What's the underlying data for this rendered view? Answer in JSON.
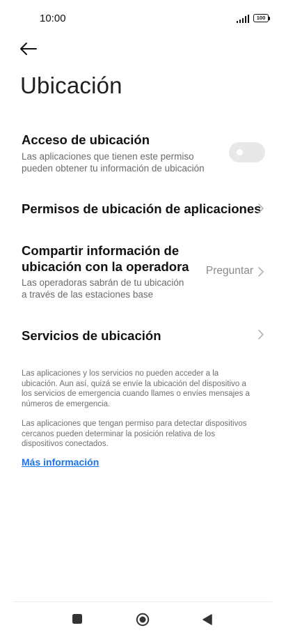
{
  "status_bar": {
    "time": "10:00",
    "battery": "100"
  },
  "header": {
    "back_icon": "arrow-left-icon",
    "title": "Ubicación"
  },
  "settings": {
    "location_access": {
      "title": "Acceso de ubicación",
      "subtitle_line1": "Las aplicaciones que tienen este permiso",
      "subtitle_line2": "pueden obtener tu información de ubicación",
      "toggle_on": false
    },
    "app_permissions": {
      "title": "Permisos de ubicación de aplicaciones"
    },
    "carrier_sharing": {
      "title_line1": "Compartir información de",
      "title_line2": "ubicación con la operadora",
      "subtitle_line1": "Las operadoras sabrán de tu ubicación",
      "subtitle_line2": "a través de las estaciones base",
      "value": "Preguntar"
    },
    "location_services": {
      "title": "Servicios de ubicación"
    }
  },
  "footnotes": {
    "note1_lines": [
      "Las aplicaciones y los servicios no pueden acceder a la",
      "ubicación. Aun así, quizá se envíe la ubicación del dispositivo a",
      "los servicios de emergencia cuando llames o envíes mensajes a",
      "números de emergencia."
    ],
    "note2_lines": [
      "Las aplicaciones que tengan permiso para detectar dispositivos",
      "cercanos pueden determinar la posición relativa de los",
      "dispositivos conectados."
    ],
    "more_info": "Más información"
  },
  "nav_bar": {
    "recents_icon": "square-icon",
    "home_icon": "circle-home-icon",
    "back_icon": "triangle-back-icon"
  },
  "colors": {
    "link": "#1a73e8",
    "toggle_off": "#e8e8e8",
    "secondary_text": "#6b6b6b"
  }
}
